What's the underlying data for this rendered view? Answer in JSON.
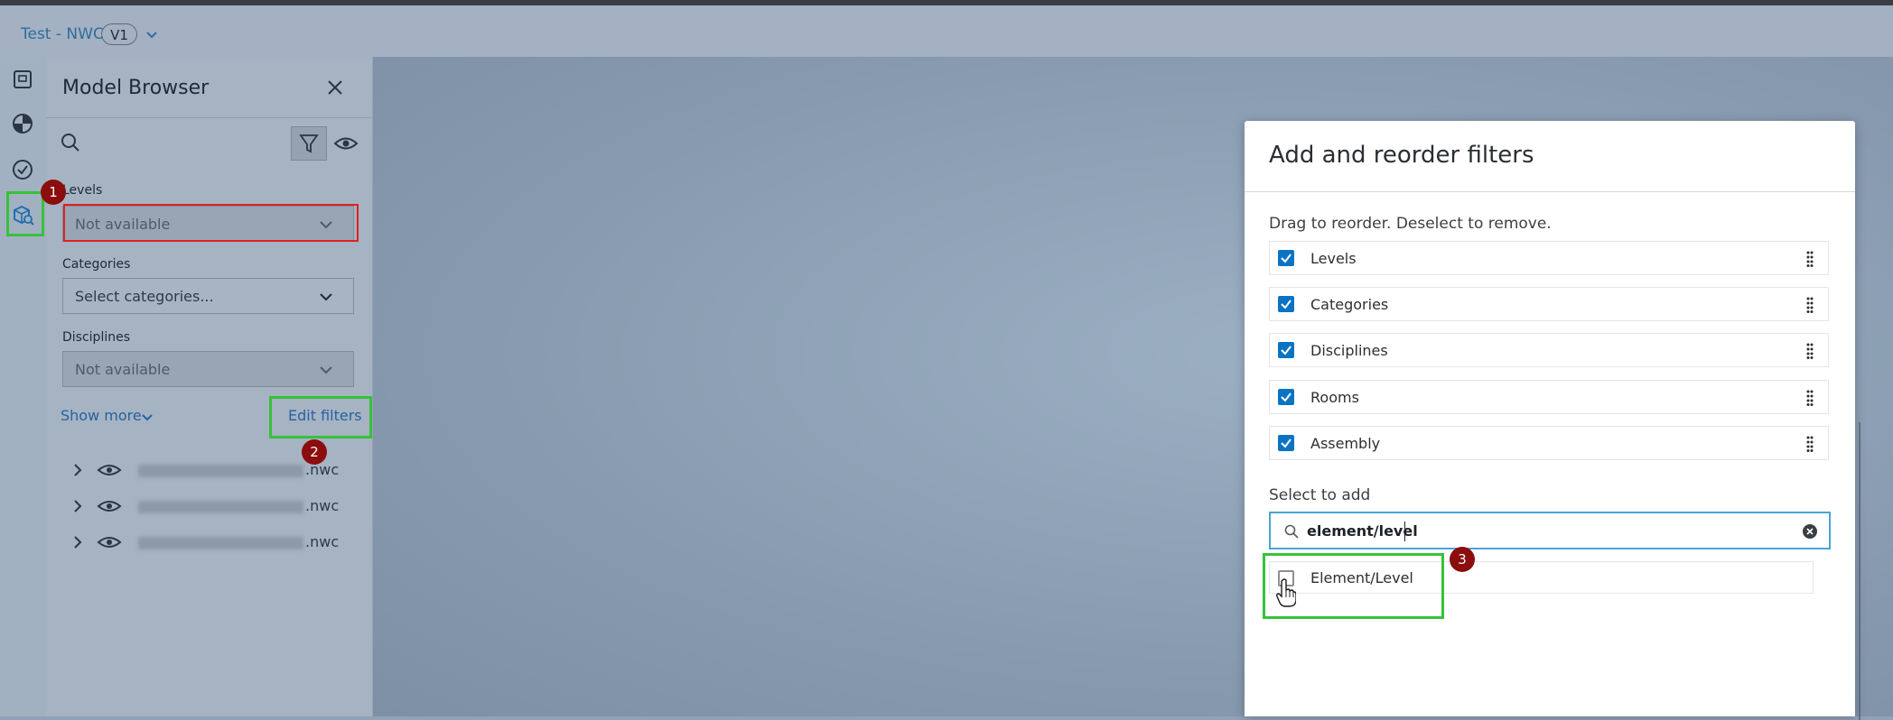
{
  "header": {
    "project_title": "Test - NWC",
    "version": "V1"
  },
  "rail": {
    "items": [
      {
        "icon": "sheets-icon"
      },
      {
        "icon": "model-icon"
      },
      {
        "icon": "check-icon"
      },
      {
        "icon": "model-browser-icon"
      }
    ]
  },
  "panel": {
    "title": "Model Browser",
    "filters": [
      {
        "label": "Levels",
        "value": "Not available"
      },
      {
        "label": "Categories",
        "value": "Select categories..."
      },
      {
        "label": "Disciplines",
        "value": "Not available"
      }
    ],
    "show_more": "Show more",
    "edit_filters": "Edit filters",
    "files": [
      {
        "name_suffix": ".nwc"
      },
      {
        "name_suffix": ".nwc"
      },
      {
        "name_suffix": ".nwc"
      }
    ]
  },
  "dialog": {
    "title": "Add and reorder filters",
    "hint": "Drag to reorder. Deselect to remove.",
    "selected_filters": [
      "Levels",
      "Categories",
      "Disciplines",
      "Rooms",
      "Assembly"
    ],
    "select_to_add_label": "Select to add",
    "search_value": "element/level",
    "results": [
      "Element/Level"
    ]
  },
  "annotations": {
    "badges": [
      "1",
      "2",
      "3"
    ]
  },
  "colors": {
    "accent": "#0b73c4",
    "highlight_green": "#36c23a",
    "highlight_red": "#e02020",
    "badge": "#8b0d0d"
  }
}
